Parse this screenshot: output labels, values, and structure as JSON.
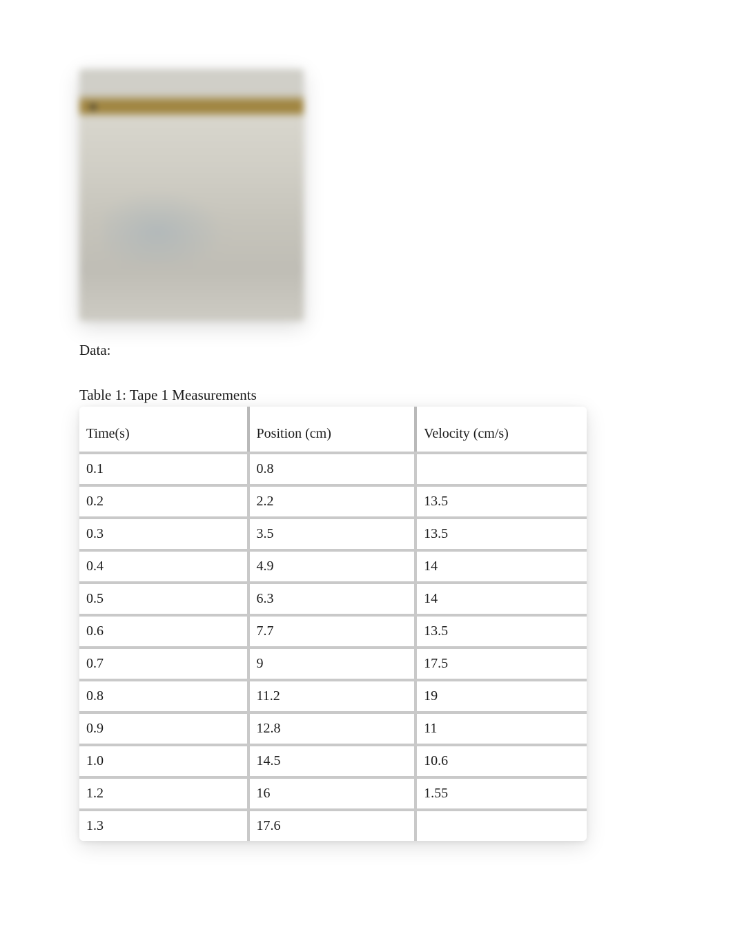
{
  "sections": {
    "data_label": "Data:"
  },
  "table": {
    "caption": "Table 1: Tape 1 Measurements",
    "headers": {
      "time": "Time(s)",
      "position": "Position (cm)",
      "velocity": "Velocity (cm/s)"
    },
    "rows": [
      {
        "time": "0.1",
        "position": "0.8",
        "velocity": ""
      },
      {
        "time": "0.2",
        "position": "2.2",
        "velocity": "13.5"
      },
      {
        "time": "0.3",
        "position": "3.5",
        "velocity": "13.5"
      },
      {
        "time": "0.4",
        "position": "4.9",
        "velocity": "14"
      },
      {
        "time": "0.5",
        "position": "6.3",
        "velocity": "14"
      },
      {
        "time": "0.6",
        "position": "7.7",
        "velocity": "13.5"
      },
      {
        "time": "0.7",
        "position": "9",
        "velocity": "17.5"
      },
      {
        "time": "0.8",
        "position": "11.2",
        "velocity": "19"
      },
      {
        "time": "0.9",
        "position": "12.8",
        "velocity": "11"
      },
      {
        "time": "1.0",
        "position": "14.5",
        "velocity": "10.6"
      },
      {
        "time": "1.2",
        "position": "16",
        "velocity": "1.55"
      },
      {
        "time": "1.3",
        "position": "17.6",
        "velocity": ""
      }
    ]
  },
  "chart_data": {
    "type": "table",
    "title": "Table 1: Tape 1 Measurements",
    "columns": [
      "Time(s)",
      "Position (cm)",
      "Velocity (cm/s)"
    ],
    "series": [
      {
        "name": "Time(s)",
        "values": [
          0.1,
          0.2,
          0.3,
          0.4,
          0.5,
          0.6,
          0.7,
          0.8,
          0.9,
          1.0,
          1.2,
          1.3
        ]
      },
      {
        "name": "Position (cm)",
        "values": [
          0.8,
          2.2,
          3.5,
          4.9,
          6.3,
          7.7,
          9,
          11.2,
          12.8,
          14.5,
          16,
          17.6
        ]
      },
      {
        "name": "Velocity (cm/s)",
        "values": [
          null,
          13.5,
          13.5,
          14,
          14,
          13.5,
          17.5,
          19,
          11,
          10.6,
          1.55,
          null
        ]
      }
    ]
  }
}
